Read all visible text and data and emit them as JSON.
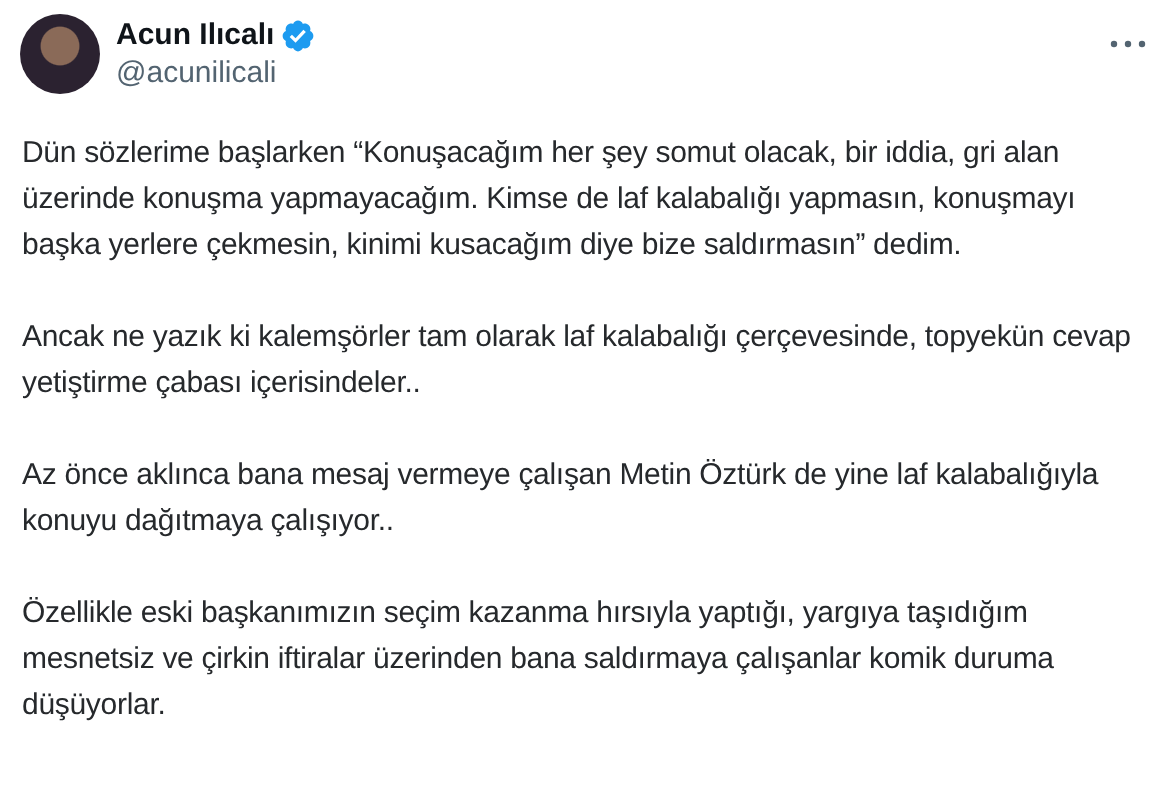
{
  "author": {
    "name": "Acun Ilıcalı",
    "verified": true,
    "handle": "@acunilicali"
  },
  "paragraphs": [
    "Dün sözlerime başlarken “Konuşacağım her şey somut olacak, bir iddia, gri alan üzerinde konuşma yapmayacağım. Kimse de laf kalabalığı yapmasın, konuşmayı başka yerlere çekmesin, kinimi kusacağım diye bize saldırmasın” dedim.",
    "Ancak ne yazık ki kalemşörler tam olarak laf kalabalığı çerçevesinde, topyekün cevap yetiştirme çabası içerisindeler..",
    "Az önce aklınca bana mesaj vermeye çalışan Metin Öztürk de yine laf kalabalığıyla konuyu dağıtmaya çalışıyor..",
    "Özellikle eski başkanımızın seçim kazanma hırsıyla yaptığı, yargıya taşıdığım mesnetsiz ve çirkin iftiralar üzerinden bana saldırmaya çalışanlar komik duruma düşüyorlar."
  ]
}
